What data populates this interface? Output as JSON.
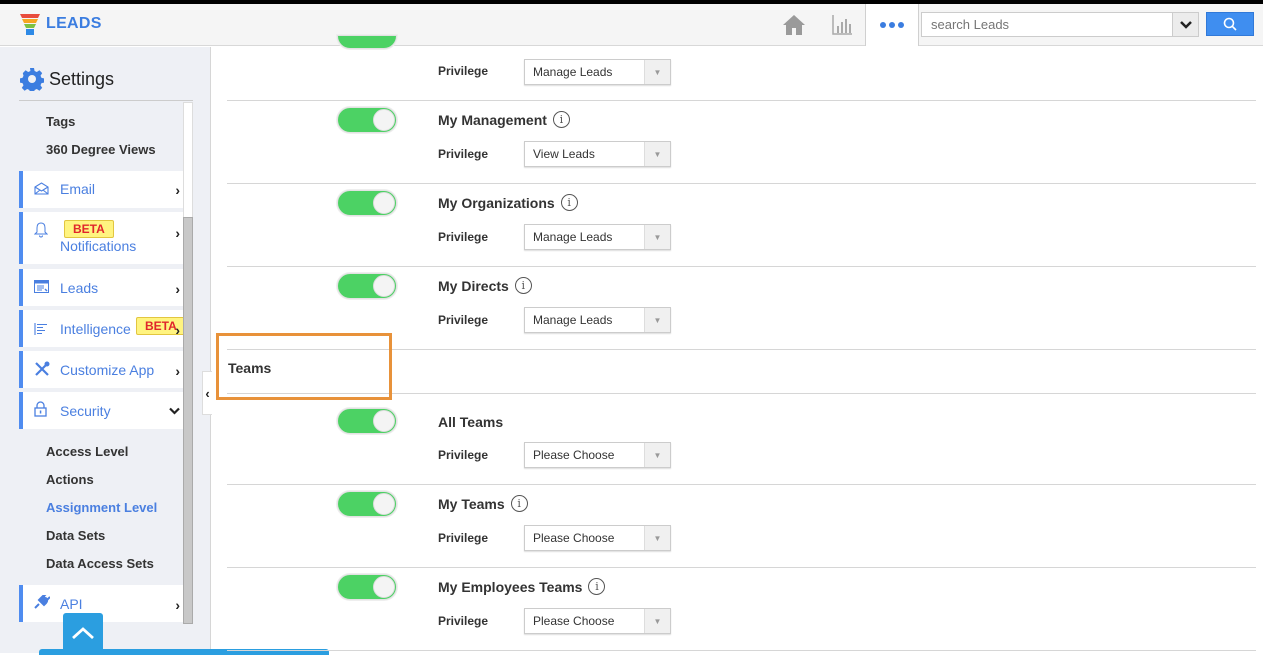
{
  "header": {
    "app_name": "LEADS",
    "icons": [
      "home-icon",
      "chart-icon",
      "more-icon"
    ],
    "search": {
      "placeholder": "search Leads",
      "value": ""
    }
  },
  "sidebar": {
    "title": "Settings",
    "top_items": [
      "Tags",
      "360 Degree Views"
    ],
    "nav": [
      {
        "label": "Email",
        "icon": "envelope-icon",
        "beta": false
      },
      {
        "label": "Notifications",
        "icon": "bell-icon",
        "beta": true
      },
      {
        "label": "Leads",
        "icon": "leads-icon",
        "beta": false
      },
      {
        "label": "Intelligence",
        "icon": "intelligence-icon",
        "beta": true
      },
      {
        "label": "Customize App",
        "icon": "tools-icon",
        "beta": false
      },
      {
        "label": "Security",
        "icon": "lock-icon",
        "beta": false,
        "expanded": true
      },
      {
        "label": "API",
        "icon": "plug-icon",
        "beta": false
      }
    ],
    "beta_label": "BETA",
    "security_sub": [
      "Access Level",
      "Actions",
      "Assignment Level",
      "Data Sets",
      "Data Access Sets"
    ],
    "active_sub": "Assignment Level"
  },
  "main": {
    "privilege_label": "Privilege",
    "first_row_select": "Manage Leads",
    "rows": [
      {
        "title": "My Management",
        "info": true,
        "enabled": true,
        "privilege": "View Leads"
      },
      {
        "title": "My Organizations",
        "info": true,
        "enabled": true,
        "privilege": "Manage Leads"
      },
      {
        "title": "My Directs",
        "info": true,
        "enabled": true,
        "privilege": "Manage Leads"
      }
    ],
    "section": "Teams",
    "team_rows": [
      {
        "title": "All Teams",
        "info": false,
        "enabled": true,
        "privilege": "Please Choose"
      },
      {
        "title": "My Teams",
        "info": true,
        "enabled": true,
        "privilege": "Please Choose"
      },
      {
        "title": "My Employees Teams",
        "info": true,
        "enabled": true,
        "privilege": "Please Choose"
      }
    ]
  },
  "colors": {
    "accent": "#3b7de0",
    "toggle_on": "#4cd264",
    "highlight": "#e8923a",
    "beta_bg": "#fff480",
    "beta_text": "#e0262c"
  }
}
